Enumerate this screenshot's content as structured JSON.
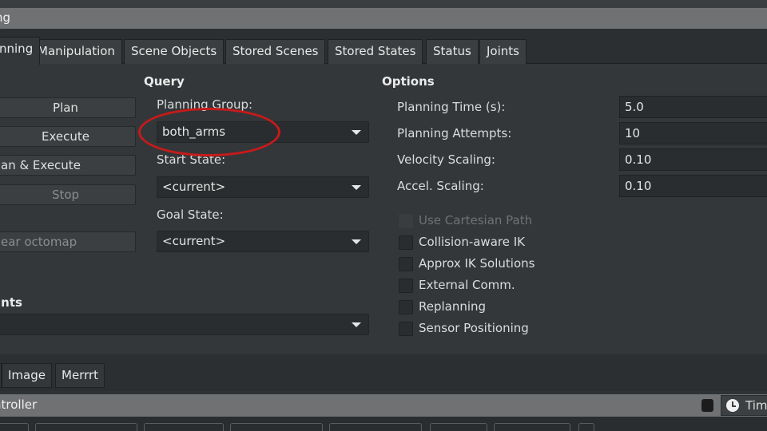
{
  "window": {
    "title": "ng"
  },
  "tabs": [
    {
      "label": "nning",
      "active": true
    },
    {
      "label": "Manipulation"
    },
    {
      "label": "Scene Objects"
    },
    {
      "label": "Stored Scenes"
    },
    {
      "label": "Stored States"
    },
    {
      "label": "Status"
    },
    {
      "label": "Joints"
    }
  ],
  "commands": {
    "plan": "Plan",
    "execute": "Execute",
    "plan_execute": "an & Execute",
    "stop": "Stop",
    "clear_octomap": "ear octomap"
  },
  "query": {
    "title": "Query",
    "planning_group_label": "Planning Group:",
    "planning_group": "both_arms",
    "start_state_label": "Start State:",
    "start_state": "<current>",
    "goal_state_label": "Goal State:",
    "goal_state": "<current>"
  },
  "constraints": {
    "title": "ints",
    "value": ""
  },
  "options": {
    "title": "Options",
    "planning_time_label": "Planning Time (s):",
    "planning_time": "5.0",
    "planning_attempts_label": "Planning Attempts:",
    "planning_attempts": "10",
    "velocity_scaling_label": "Velocity Scaling:",
    "velocity_scaling": "0.10",
    "accel_scaling_label": "Accel. Scaling:",
    "accel_scaling": "0.10",
    "checkboxes": [
      {
        "label": "Use Cartesian Path",
        "disabled": true
      },
      {
        "label": "Collision-aware IK"
      },
      {
        "label": "Approx IK Solutions"
      },
      {
        "label": "External Comm."
      },
      {
        "label": "Replanning"
      },
      {
        "label": "Sensor Positioning"
      }
    ]
  },
  "bottom_tabs": [
    {
      "label": "Image"
    },
    {
      "label": "Merrrt"
    }
  ],
  "controller": {
    "title": "ntroller",
    "time_label": "Tim"
  },
  "colors": {
    "annotation": "#c81a1a",
    "panel": "#33373a",
    "titlebar": "#6f7173"
  }
}
